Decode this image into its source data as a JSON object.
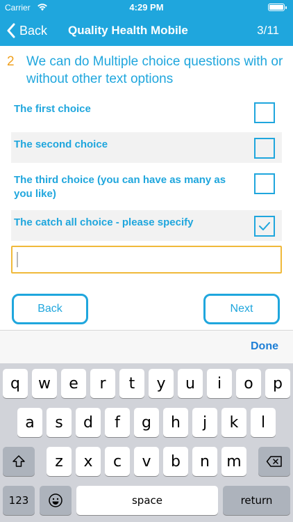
{
  "status_bar": {
    "carrier": "Carrier",
    "time": "4:29 PM"
  },
  "nav": {
    "back_label": "Back",
    "title": "Quality Health Mobile",
    "progress": "3/11"
  },
  "question": {
    "number": "2",
    "text": "We can do Multiple choice questions with or without other text options"
  },
  "choices": [
    {
      "label": "The first choice",
      "checked": false
    },
    {
      "label": "The second choice",
      "checked": false
    },
    {
      "label": "The third choice (you can have as many as you like)",
      "checked": false
    },
    {
      "label": "The catch all choice - please specify",
      "checked": true
    }
  ],
  "other_input": {
    "value": ""
  },
  "buttons": {
    "back_label": "Back",
    "next_label": "Next"
  },
  "accessory": {
    "done_label": "Done"
  },
  "keyboard": {
    "row1": [
      "q",
      "w",
      "e",
      "r",
      "t",
      "y",
      "u",
      "i",
      "o",
      "p"
    ],
    "row2": [
      "a",
      "s",
      "d",
      "f",
      "g",
      "h",
      "j",
      "k",
      "l"
    ],
    "row3": [
      "z",
      "x",
      "c",
      "v",
      "b",
      "n",
      "m"
    ],
    "numbers_label": "123",
    "space_label": "space",
    "return_label": "return"
  },
  "colors": {
    "accent": "#1fa6dd",
    "number": "#f0a01e",
    "input_border": "#f0b93a",
    "done": "#1e7fd6"
  }
}
